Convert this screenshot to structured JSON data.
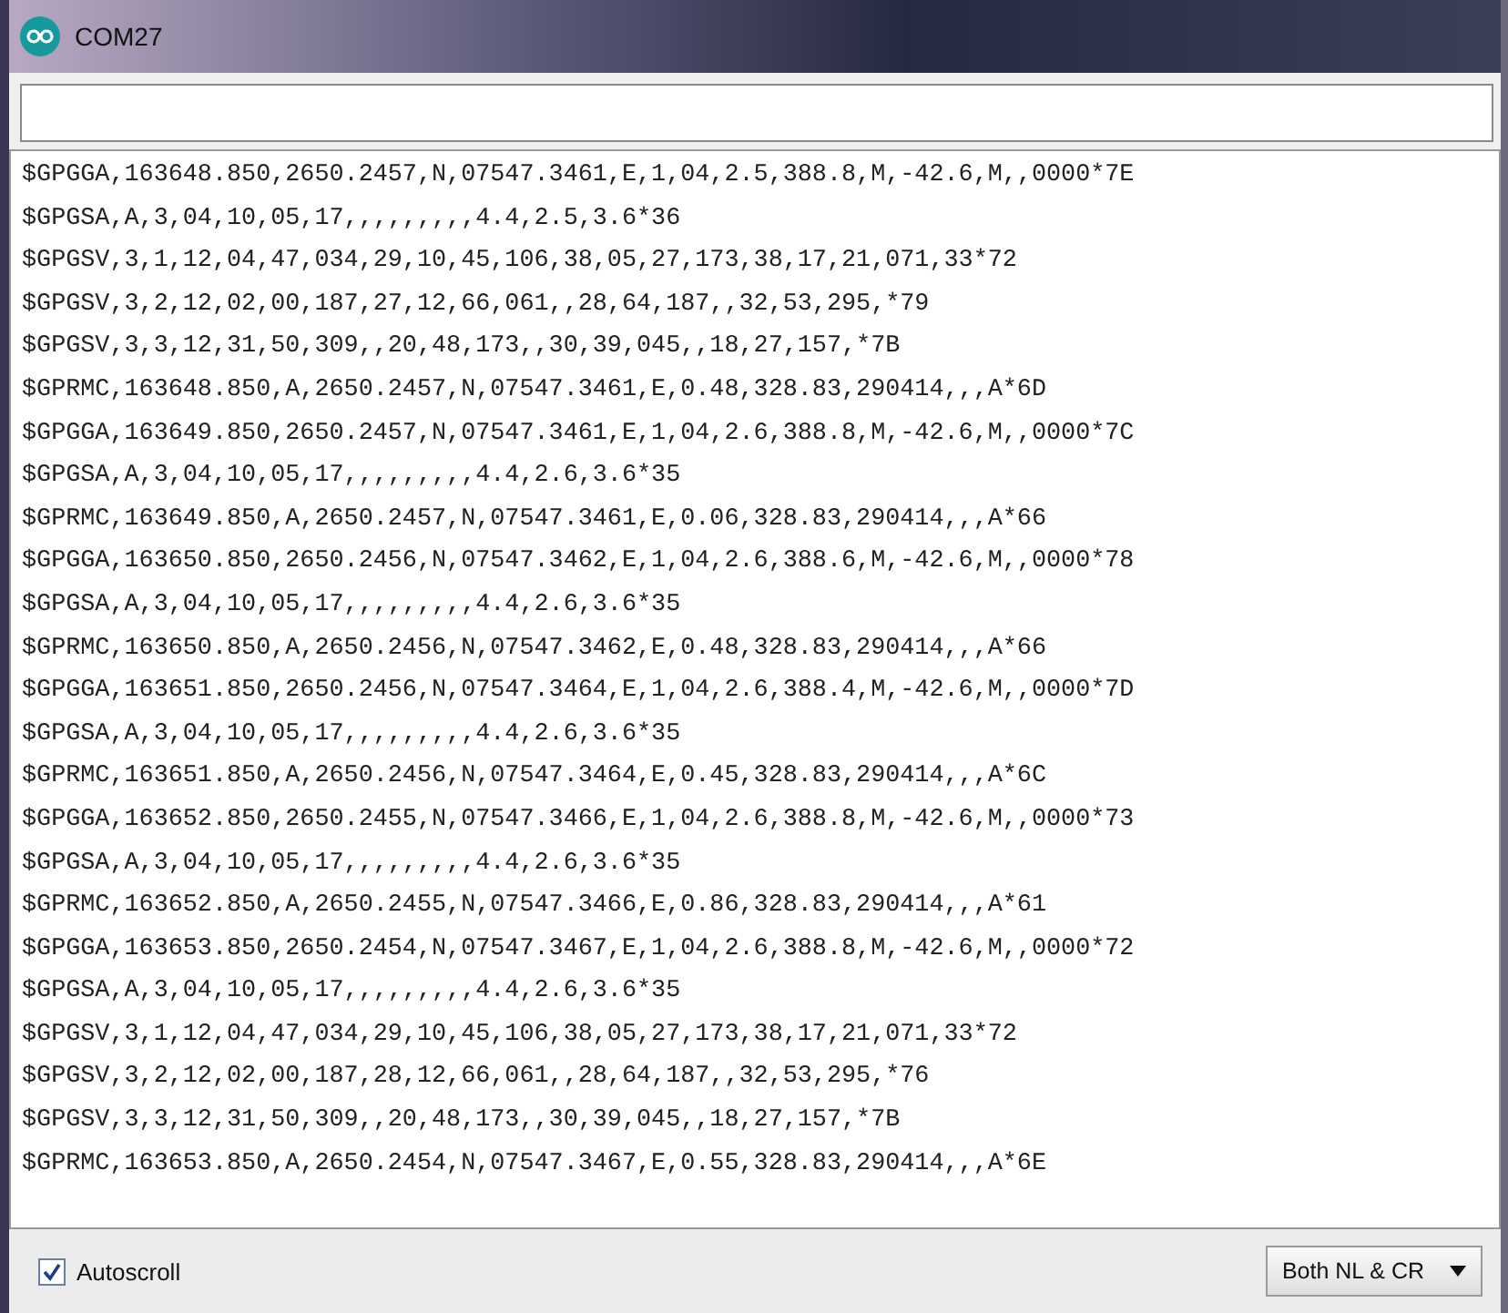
{
  "window": {
    "title": "COM27"
  },
  "output_lines": [
    "$GPGGA,163648.850,2650.2457,N,07547.3461,E,1,04,2.5,388.8,M,-42.6,M,,0000*7E",
    "$GPGSA,A,3,04,10,05,17,,,,,,,,,4.4,2.5,3.6*36",
    "$GPGSV,3,1,12,04,47,034,29,10,45,106,38,05,27,173,38,17,21,071,33*72",
    "$GPGSV,3,2,12,02,00,187,27,12,66,061,,28,64,187,,32,53,295,*79",
    "$GPGSV,3,3,12,31,50,309,,20,48,173,,30,39,045,,18,27,157,*7B",
    "$GPRMC,163648.850,A,2650.2457,N,07547.3461,E,0.48,328.83,290414,,,A*6D",
    "$GPGGA,163649.850,2650.2457,N,07547.3461,E,1,04,2.6,388.8,M,-42.6,M,,0000*7C",
    "$GPGSA,A,3,04,10,05,17,,,,,,,,,4.4,2.6,3.6*35",
    "$GPRMC,163649.850,A,2650.2457,N,07547.3461,E,0.06,328.83,290414,,,A*66",
    "$GPGGA,163650.850,2650.2456,N,07547.3462,E,1,04,2.6,388.6,M,-42.6,M,,0000*78",
    "$GPGSA,A,3,04,10,05,17,,,,,,,,,4.4,2.6,3.6*35",
    "$GPRMC,163650.850,A,2650.2456,N,07547.3462,E,0.48,328.83,290414,,,A*66",
    "$GPGGA,163651.850,2650.2456,N,07547.3464,E,1,04,2.6,388.4,M,-42.6,M,,0000*7D",
    "$GPGSA,A,3,04,10,05,17,,,,,,,,,4.4,2.6,3.6*35",
    "$GPRMC,163651.850,A,2650.2456,N,07547.3464,E,0.45,328.83,290414,,,A*6C",
    "$GPGGA,163652.850,2650.2455,N,07547.3466,E,1,04,2.6,388.8,M,-42.6,M,,0000*73",
    "$GPGSA,A,3,04,10,05,17,,,,,,,,,4.4,2.6,3.6*35",
    "$GPRMC,163652.850,A,2650.2455,N,07547.3466,E,0.86,328.83,290414,,,A*61",
    "$GPGGA,163653.850,2650.2454,N,07547.3467,E,1,04,2.6,388.8,M,-42.6,M,,0000*72",
    "$GPGSA,A,3,04,10,05,17,,,,,,,,,4.4,2.6,3.6*35",
    "$GPGSV,3,1,12,04,47,034,29,10,45,106,38,05,27,173,38,17,21,071,33*72",
    "$GPGSV,3,2,12,02,00,187,28,12,66,061,,28,64,187,,32,53,295,*76",
    "$GPGSV,3,3,12,31,50,309,,20,48,173,,30,39,045,,18,27,157,*7B",
    "$GPRMC,163653.850,A,2650.2454,N,07547.3467,E,0.55,328.83,290414,,,A*6E"
  ],
  "autoscroll": {
    "label": "Autoscroll",
    "checked": true
  },
  "line_ending": {
    "value": "Both NL & CR"
  }
}
